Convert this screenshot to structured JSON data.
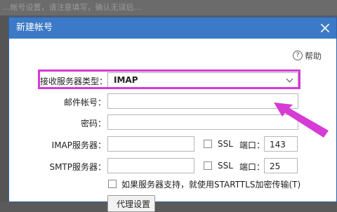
{
  "background": {
    "text": "...帐号设置，请注意填写，确认无误后..."
  },
  "dialog": {
    "title": "新建帐号",
    "help_label": "帮助",
    "help_icon": "question-circle-icon",
    "close_icon": "close-icon"
  },
  "form": {
    "server_type_label": "接收服务器类型：",
    "server_type_value": "IMAP",
    "account_label": "邮件帐号：",
    "account_value": "",
    "password_label": "密码：",
    "password_value": "",
    "imap_label": "IMAP服务器：",
    "imap_value": "",
    "imap_ssl_label": "SSL",
    "imap_port_label": "端口：",
    "imap_port_value": "143",
    "smtp_label": "SMTP服务器：",
    "smtp_value": "",
    "smtp_ssl_label": "SSL",
    "smtp_port_label": "端口：",
    "smtp_port_value": "25",
    "starttls_label": "如果服务器支持，就使用STARTTLS加密传输(T)",
    "proxy_button_label": "代理设置"
  },
  "annotation": {
    "highlight_color": "#d63bd6",
    "arrow_color": "#d63bd6"
  }
}
